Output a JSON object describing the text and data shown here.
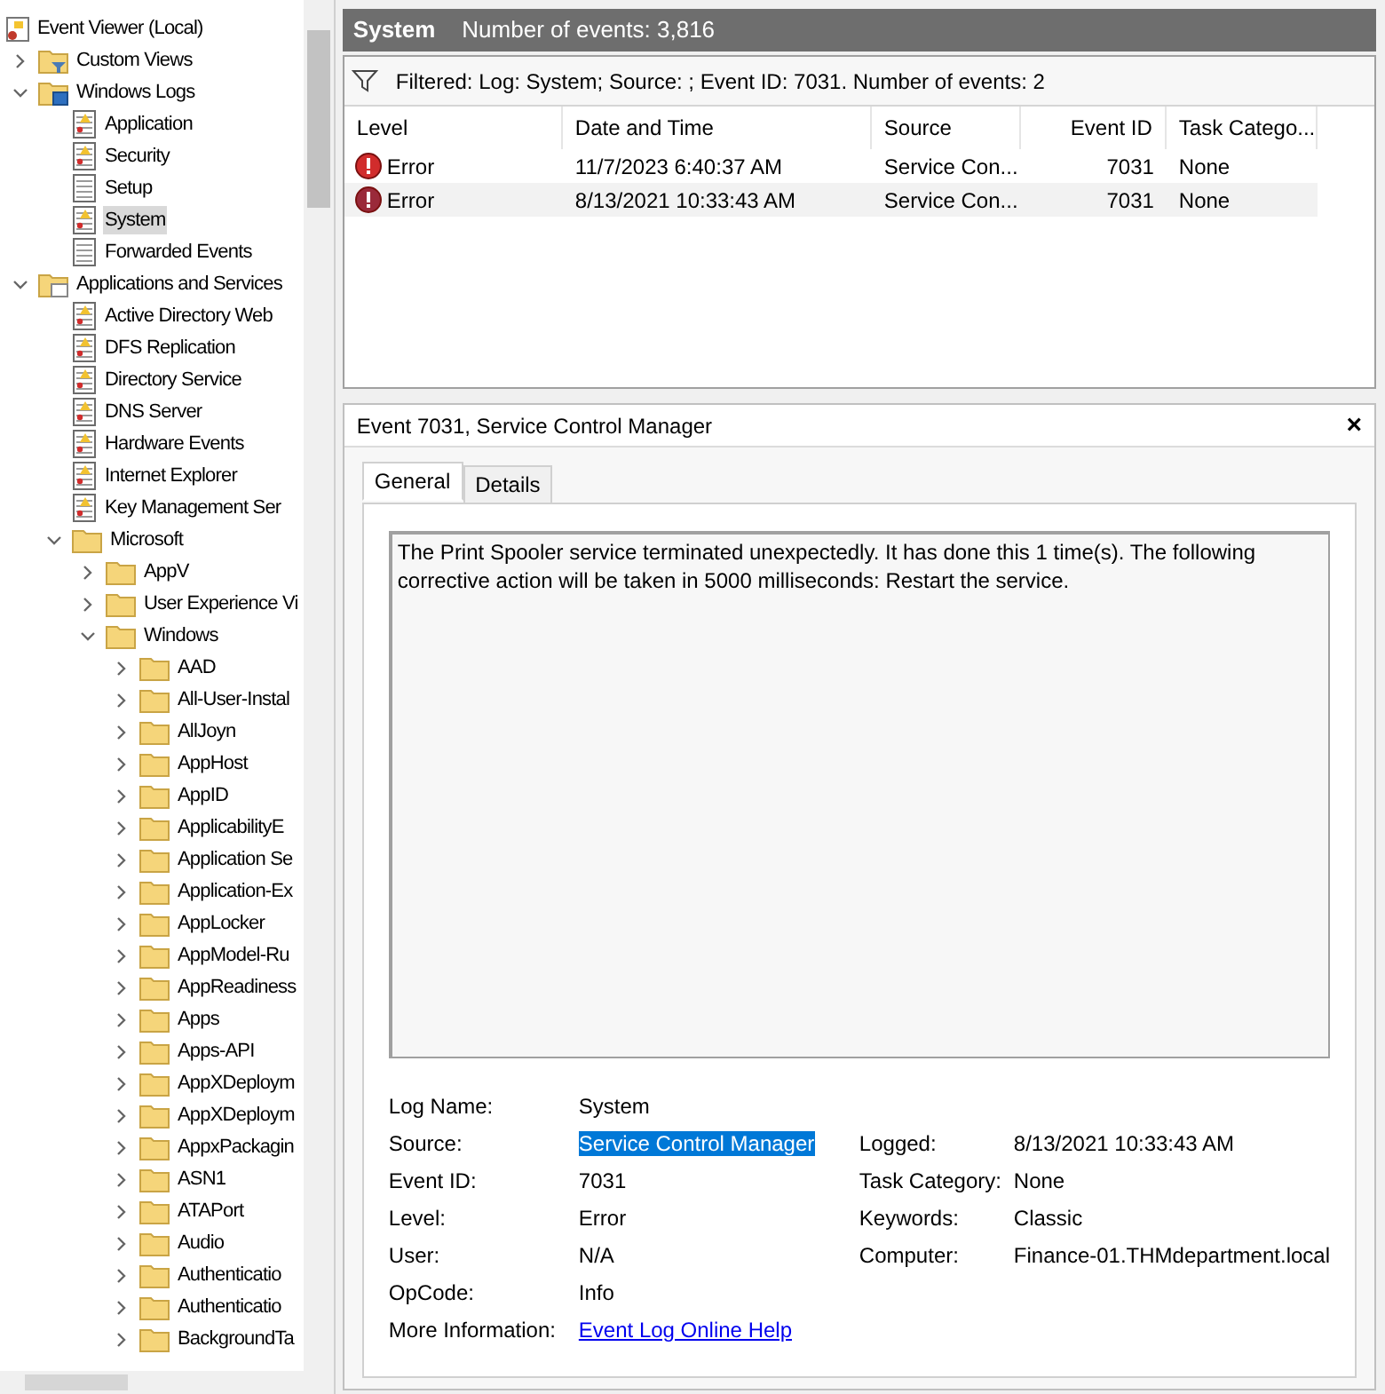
{
  "tree": {
    "label": "Event Viewer (Local)",
    "kind": "root",
    "children": [
      {
        "label": "Custom Views",
        "kind": "filter-folder",
        "expanded": false,
        "selected": false
      },
      {
        "label": "Windows Logs",
        "kind": "logs-folder",
        "expanded": true,
        "selected": false,
        "children": [
          {
            "label": "Application",
            "kind": "log",
            "selected": false
          },
          {
            "label": "Security",
            "kind": "log",
            "selected": false
          },
          {
            "label": "Setup",
            "kind": "plain-log",
            "selected": false
          },
          {
            "label": "System",
            "kind": "log",
            "selected": true
          },
          {
            "label": "Forwarded Events",
            "kind": "plain-log",
            "selected": false
          }
        ]
      },
      {
        "label": "Applications and Services",
        "kind": "app-folder",
        "expanded": true,
        "selected": false,
        "children": [
          {
            "label": "Active Directory Web",
            "kind": "log",
            "selected": false
          },
          {
            "label": "DFS Replication",
            "kind": "log",
            "selected": false
          },
          {
            "label": "Directory Service",
            "kind": "log",
            "selected": false
          },
          {
            "label": "DNS Server",
            "kind": "log",
            "selected": false
          },
          {
            "label": "Hardware Events",
            "kind": "log",
            "selected": false
          },
          {
            "label": "Internet Explorer",
            "kind": "log",
            "selected": false
          },
          {
            "label": "Key Management Ser",
            "kind": "log",
            "selected": false
          },
          {
            "label": "Microsoft",
            "kind": "folder",
            "expanded": true,
            "selected": false,
            "children": [
              {
                "label": "AppV",
                "kind": "folder",
                "expanded": false,
                "selected": false
              },
              {
                "label": "User Experience Vi",
                "kind": "folder",
                "expanded": false,
                "selected": false
              },
              {
                "label": "Windows",
                "kind": "folder",
                "expanded": true,
                "selected": false,
                "children": [
                  {
                    "label": "AAD",
                    "kind": "folder",
                    "expanded": false,
                    "selected": false
                  },
                  {
                    "label": "All-User-Instal",
                    "kind": "folder",
                    "expanded": false,
                    "selected": false
                  },
                  {
                    "label": "AllJoyn",
                    "kind": "folder",
                    "expanded": false,
                    "selected": false
                  },
                  {
                    "label": "AppHost",
                    "kind": "folder",
                    "expanded": false,
                    "selected": false
                  },
                  {
                    "label": "AppID",
                    "kind": "folder",
                    "expanded": false,
                    "selected": false
                  },
                  {
                    "label": "ApplicabilityE",
                    "kind": "folder",
                    "expanded": false,
                    "selected": false
                  },
                  {
                    "label": "Application Se",
                    "kind": "folder",
                    "expanded": false,
                    "selected": false
                  },
                  {
                    "label": "Application-Ex",
                    "kind": "folder",
                    "expanded": false,
                    "selected": false
                  },
                  {
                    "label": "AppLocker",
                    "kind": "folder",
                    "expanded": false,
                    "selected": false
                  },
                  {
                    "label": "AppModel-Ru",
                    "kind": "folder",
                    "expanded": false,
                    "selected": false
                  },
                  {
                    "label": "AppReadiness",
                    "kind": "folder",
                    "expanded": false,
                    "selected": false
                  },
                  {
                    "label": "Apps",
                    "kind": "folder",
                    "expanded": false,
                    "selected": false
                  },
                  {
                    "label": "Apps-API",
                    "kind": "folder",
                    "expanded": false,
                    "selected": false
                  },
                  {
                    "label": "AppXDeploym",
                    "kind": "folder",
                    "expanded": false,
                    "selected": false
                  },
                  {
                    "label": "AppXDeploym",
                    "kind": "folder",
                    "expanded": false,
                    "selected": false
                  },
                  {
                    "label": "AppxPackagin",
                    "kind": "folder",
                    "expanded": false,
                    "selected": false
                  },
                  {
                    "label": "ASN1",
                    "kind": "folder",
                    "expanded": false,
                    "selected": false
                  },
                  {
                    "label": "ATAPort",
                    "kind": "folder",
                    "expanded": false,
                    "selected": false
                  },
                  {
                    "label": "Audio",
                    "kind": "folder",
                    "expanded": false,
                    "selected": false
                  },
                  {
                    "label": "Authenticatio",
                    "kind": "folder",
                    "expanded": false,
                    "selected": false
                  },
                  {
                    "label": "Authenticatio",
                    "kind": "folder",
                    "expanded": false,
                    "selected": false
                  },
                  {
                    "label": "BackgroundTa",
                    "kind": "folder",
                    "expanded": false,
                    "selected": false
                  }
                ]
              }
            ]
          }
        ]
      }
    ]
  },
  "header": {
    "title": "System",
    "count": "Number of events: 3,816"
  },
  "filter": "Filtered: Log: System; Source: ; Event ID: 7031. Number of events: 2",
  "table": {
    "columns": [
      "Level",
      "Date and Time",
      "Source",
      "Event ID",
      "Task Catego..."
    ],
    "rows": [
      {
        "level": "Error",
        "date": "11/7/2023 6:40:37 AM",
        "source": "Service Con...",
        "event_id": "7031",
        "task": "None",
        "selected": false
      },
      {
        "level": "Error",
        "date": "8/13/2021 10:33:43 AM",
        "source": "Service Con...",
        "event_id": "7031",
        "task": "None",
        "selected": true
      }
    ]
  },
  "details": {
    "title": "Event 7031, Service Control Manager",
    "close": "×",
    "tabs": [
      {
        "label": "General",
        "selected": true
      },
      {
        "label": "Details",
        "selected": false
      }
    ],
    "message": "The Print Spooler service terminated unexpectedly.  It has done this 1 time(s).  The following corrective action will be taken in 5000 milliseconds: Restart the service.",
    "fields": [
      {
        "label": "Log Name:",
        "value": "System"
      },
      {
        "label": "Source:",
        "value": "Service Control Manager",
        "highlighted": true,
        "label2": "Logged:",
        "value2": "8/13/2021 10:33:43 AM"
      },
      {
        "label": "Event ID:",
        "value": "7031",
        "label2": "Task Category:",
        "value2": "None"
      },
      {
        "label": "Level:",
        "value": "Error",
        "label2": "Keywords:",
        "value2": "Classic"
      },
      {
        "label": "User:",
        "value": "N/A",
        "label2": "Computer:",
        "value2": "Finance-01.THMdepartment.local"
      },
      {
        "label": "OpCode:",
        "value": "Info"
      }
    ],
    "more_info": {
      "label": "More Information:",
      "link": "Event Log Online Help"
    }
  }
}
